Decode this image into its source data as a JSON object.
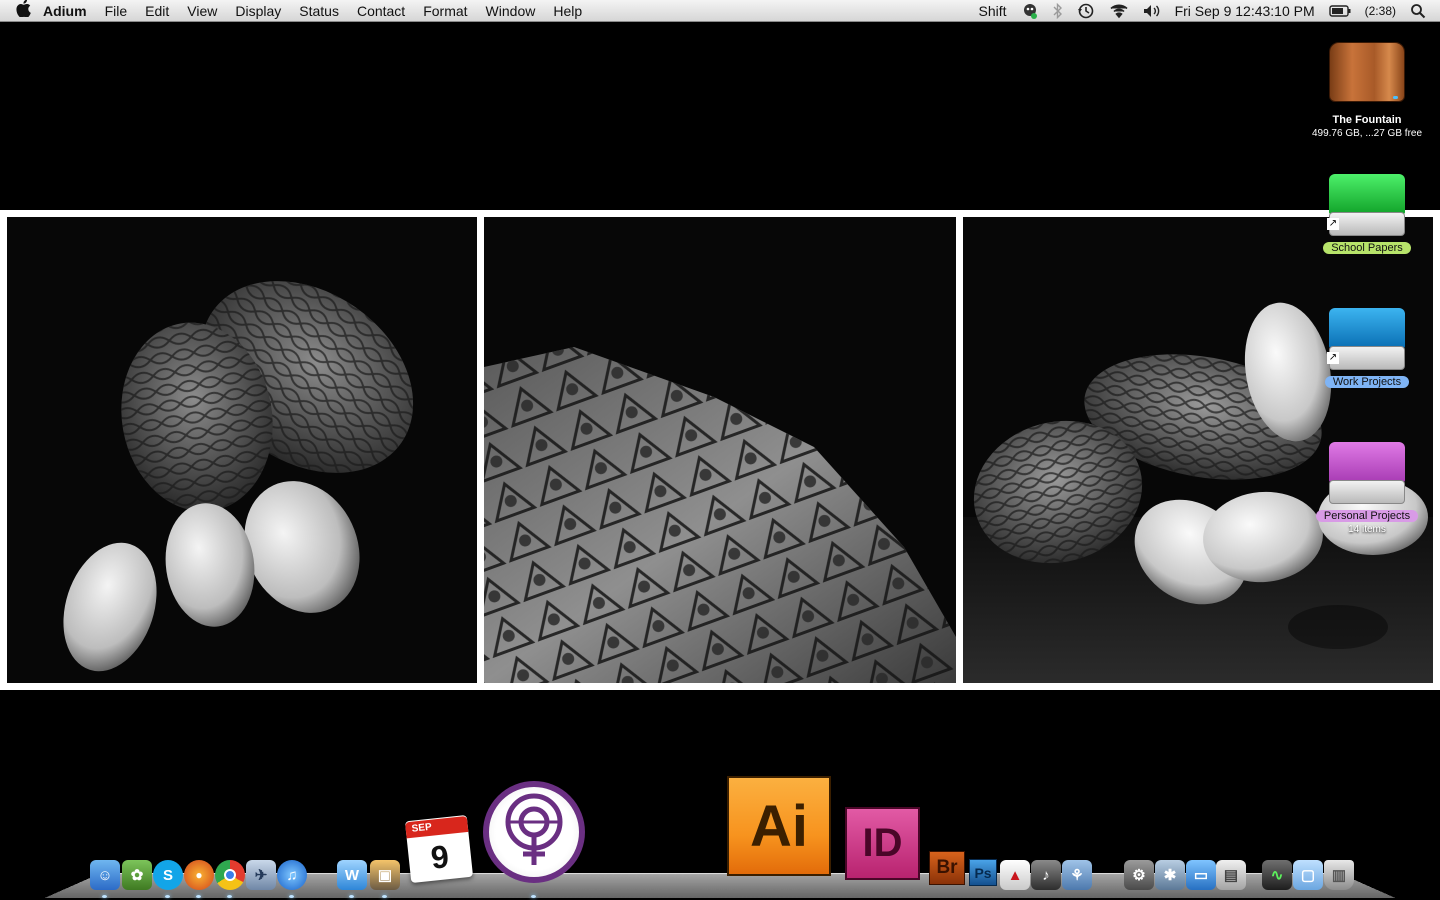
{
  "menubar": {
    "app_name": "Adium",
    "menus": [
      "File",
      "Edit",
      "View",
      "Display",
      "Status",
      "Contact",
      "Format",
      "Window",
      "Help"
    ],
    "status_text": "Shift",
    "clock": "Fri Sep 9  12:43:10 PM",
    "battery": "(2:38)"
  },
  "desktop_icons": {
    "drive1": {
      "name": "The Fountain",
      "info": "499.76 GB, ...27 GB free"
    },
    "drive2": {
      "name": "School Papers"
    },
    "drive3": {
      "name": "Work Projects"
    },
    "drive4": {
      "name": "Personal Projects",
      "info": "14 items"
    }
  },
  "dock": {
    "calendar_month": "SEP",
    "calendar_day": "9",
    "illustrator": "Ai",
    "indesign": "ID",
    "bridge": "Br",
    "photoshop": "Ps"
  },
  "colors": {
    "illustrator": "#f7931e",
    "indesign": "#d7348c",
    "bridge": "#b3490e",
    "photoshop": "#1c5fa8",
    "drive_green": "#22c03c",
    "drive_blue": "#1389d0",
    "drive_purple": "#c055c9"
  }
}
